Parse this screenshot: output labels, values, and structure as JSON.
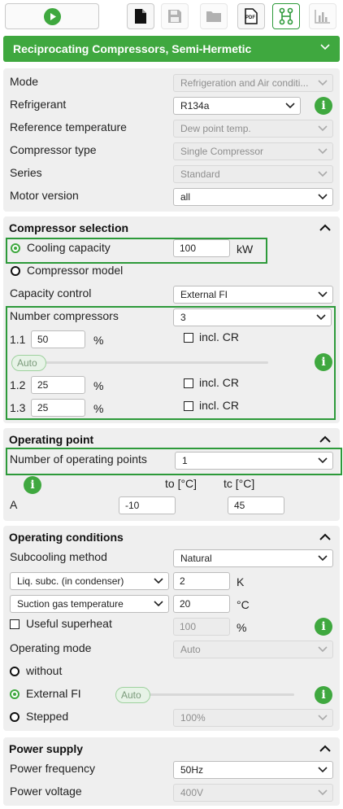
{
  "toolbar": {
    "play": "play-button",
    "icons": [
      "new-file-icon",
      "save-icon",
      "open-folder-icon",
      "pdf-icon",
      "compressor-config-icon",
      "chart-icon"
    ],
    "pdf_label": "PDF"
  },
  "header": {
    "title": "Reciprocating Compressors, Semi-Hermetic"
  },
  "general": {
    "mode_label": "Mode",
    "mode_value": "Refrigeration and Air conditi...",
    "refrigerant_label": "Refrigerant",
    "refrigerant_value": "R134a",
    "reftemp_label": "Reference temperature",
    "reftemp_value": "Dew point temp.",
    "comptype_label": "Compressor type",
    "comptype_value": "Single Compressor",
    "series_label": "Series",
    "series_value": "Standard",
    "motor_label": "Motor version",
    "motor_value": "all"
  },
  "compressor_selection": {
    "title": "Compressor selection",
    "cooling_label": "Cooling capacity",
    "cooling_value": "100",
    "cooling_unit": "kW",
    "model_label": "Compressor model",
    "capctrl_label": "Capacity control",
    "capctrl_value": "External FI",
    "number_label": "Number compressors",
    "number_value": "3",
    "rows": [
      {
        "id": "1.1",
        "value": "50",
        "unit": "%",
        "cr": "incl. CR"
      },
      {
        "id": "1.2",
        "value": "25",
        "unit": "%",
        "cr": "incl. CR"
      },
      {
        "id": "1.3",
        "value": "25",
        "unit": "%",
        "cr": "incl. CR"
      }
    ],
    "auto_label": "Auto"
  },
  "operating_point": {
    "title": "Operating point",
    "num_label": "Number of operating points",
    "num_value": "1",
    "col_to": "to [°C]",
    "col_tc": "tc [°C]",
    "row_label": "A",
    "to_value": "-10",
    "tc_value": "45"
  },
  "operating_conditions": {
    "title": "Operating conditions",
    "subcool_label": "Subcooling method",
    "subcool_value": "Natural",
    "liq_select": "Liq. subc. (in condenser)",
    "liq_value": "2",
    "liq_unit": "K",
    "suction_select": "Suction gas temperature",
    "suction_value": "20",
    "suction_unit": "°C",
    "useful_label": "Useful superheat",
    "useful_value": "100",
    "useful_unit": "%",
    "opmode_label": "Operating mode",
    "opmode_value": "Auto",
    "without_label": "without",
    "extfi_label": "External FI",
    "extfi_auto": "Auto",
    "stepped_label": "Stepped",
    "stepped_value": "100%"
  },
  "power_supply": {
    "title": "Power supply",
    "freq_label": "Power frequency",
    "freq_value": "50Hz",
    "volt_label": "Power voltage",
    "volt_value": "400V"
  },
  "colors": {
    "accent": "#3fa83f",
    "panel": "#efefef"
  }
}
